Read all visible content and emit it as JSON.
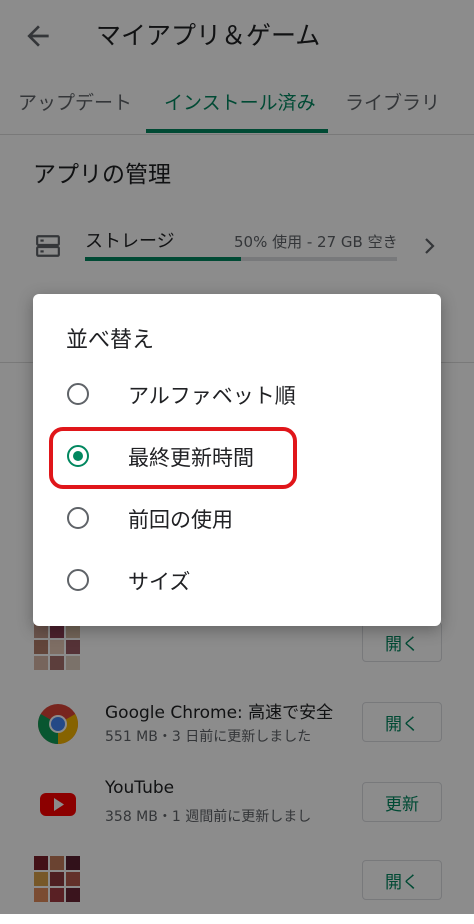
{
  "header": {
    "title": "マイアプリ＆ゲーム"
  },
  "tabs": [
    {
      "label": "アップデート"
    },
    {
      "label": "インストール済み"
    },
    {
      "label": "ライブラリ"
    }
  ],
  "section": {
    "title": "アプリの管理"
  },
  "storage": {
    "label": "ストレージ",
    "info": "50% 使用 - 27 GB 空き",
    "used_fraction": 0.5
  },
  "apps": [
    {
      "name": "",
      "sub": "",
      "button": "開く"
    },
    {
      "name": "Google Chrome: 高速で安全",
      "sub": "551 MB・3 日前に更新しました",
      "button": "開く"
    },
    {
      "name": "YouTube",
      "sub": "358 MB・1 週間前に更新しまし",
      "button": "更新"
    },
    {
      "name": "",
      "sub": "",
      "button": "開く"
    }
  ],
  "dialog": {
    "title": "並べ替え",
    "options": [
      {
        "label": "アルファベット順",
        "selected": false
      },
      {
        "label": "最終更新時間",
        "selected": true
      },
      {
        "label": "前回の使用",
        "selected": false
      },
      {
        "label": "サイズ",
        "selected": false
      }
    ]
  },
  "colors": {
    "accent": "#01875f",
    "highlight": "#e0161a"
  }
}
